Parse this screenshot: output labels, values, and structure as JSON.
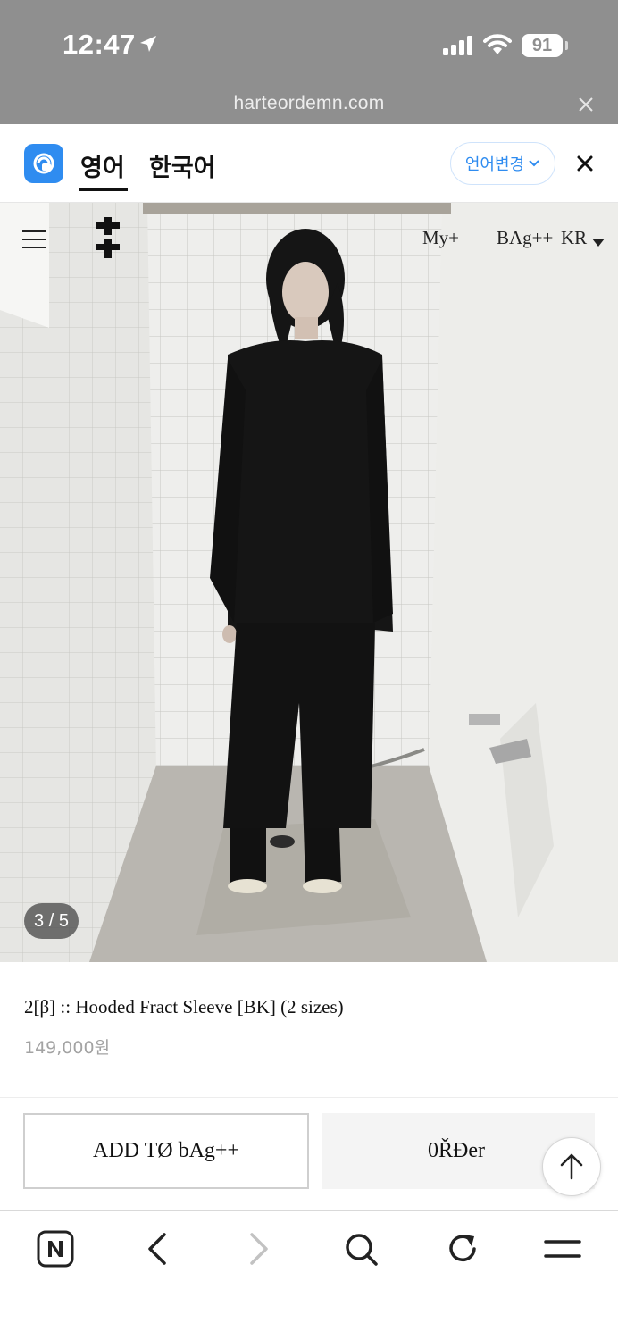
{
  "status_bar": {
    "time": "12:47",
    "battery": "91",
    "url": "harteordemn.com"
  },
  "translate_bar": {
    "tabs": [
      "영어",
      "한국어"
    ],
    "active_tab": "영어",
    "change_language": "언어변경",
    "accent_color": "#2f8cf0"
  },
  "site_header": {
    "my_link": "My+",
    "bag_link": "BAg++",
    "lang": "KR"
  },
  "gallery": {
    "counter": "3 / 5"
  },
  "product": {
    "title": "2[β] :: Hooded Fract Sleeve [BK] (2 sizes)",
    "price": "149,000원"
  },
  "actions": {
    "add_to_bag": "ADD TØ bAg++",
    "order": "0ŘĐer"
  },
  "icons": {
    "location": "location-arrow-icon",
    "signal": "cellular-signal-icon",
    "wifi": "wifi-icon",
    "menu": "hamburger-menu-icon",
    "logo": "double-cross-logo-icon",
    "scroll_top": "arrow-up-icon",
    "browser": [
      "naver-n-icon",
      "back-icon",
      "forward-icon",
      "search-icon",
      "reload-icon",
      "menu-icon"
    ]
  }
}
